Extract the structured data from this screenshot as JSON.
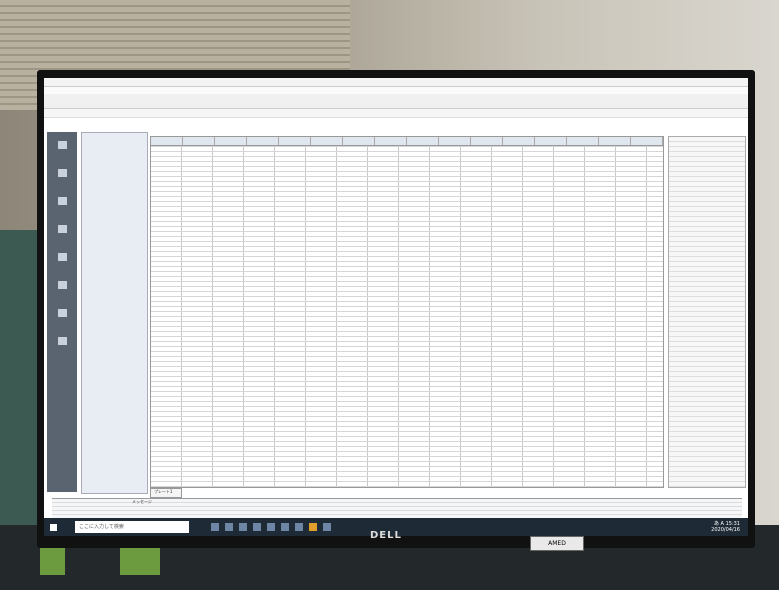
{
  "search": {
    "placeholder": "ここに入力して検索"
  },
  "monitor": {
    "brand": "DELL",
    "sticker": "AMED"
  },
  "tray": {
    "time": "15:31",
    "date": "2020/04/16",
    "ime": "あ A"
  },
  "sheet": {
    "tab": "プレート1"
  },
  "messages": {
    "header": "メッセージ"
  }
}
